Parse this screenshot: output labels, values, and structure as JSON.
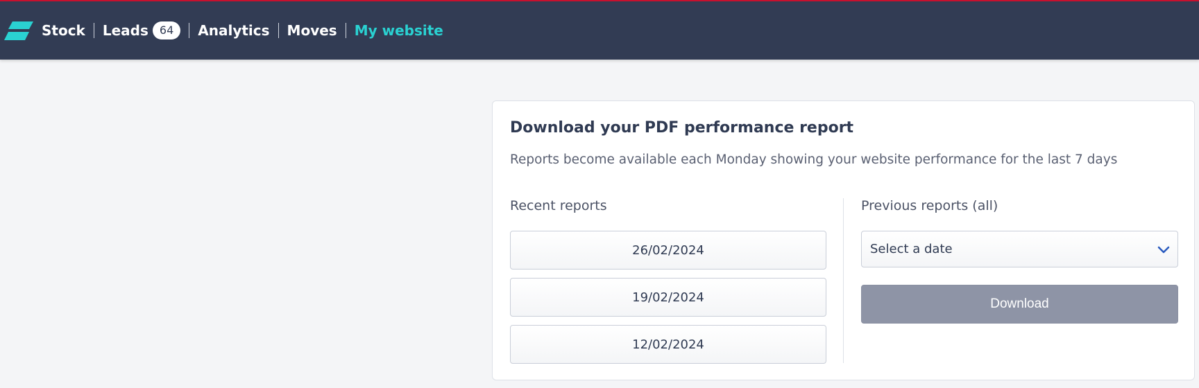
{
  "nav": {
    "logo": "brand-logo",
    "items": [
      {
        "label": "Stock"
      },
      {
        "label": "Leads",
        "badge": "64"
      },
      {
        "label": "Analytics"
      },
      {
        "label": "Moves"
      },
      {
        "label": "My website",
        "active": true
      }
    ]
  },
  "report": {
    "title": "Download your PDF performance report",
    "subtitle": "Reports become available each Monday showing your website performance for the last 7 days",
    "recent_label": "Recent reports",
    "recent_dates": [
      "26/02/2024",
      "19/02/2024",
      "12/02/2024"
    ],
    "previous_label": "Previous reports (all)",
    "select_value": "Select a date",
    "download_label": "Download"
  },
  "colors": {
    "topbar": "#323c54",
    "accent": "#2ad2d2",
    "top_border": "#c8102e",
    "download_disabled": "#8e94a6"
  }
}
